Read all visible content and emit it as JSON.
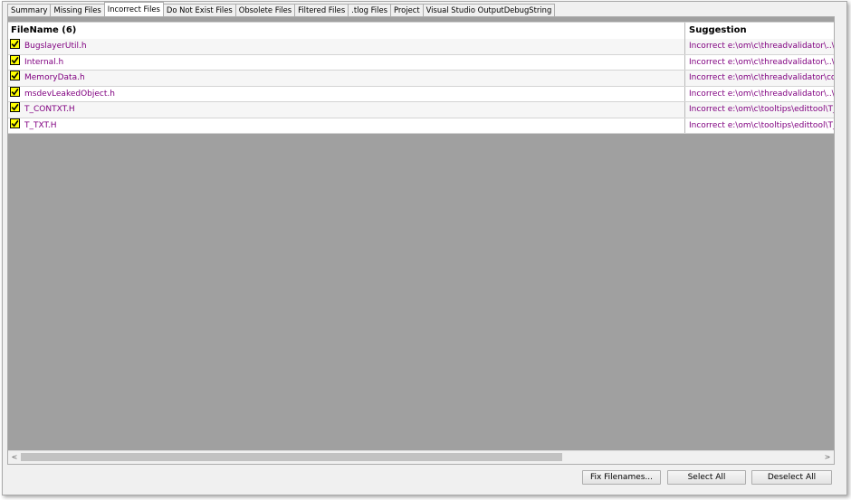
{
  "tabs": [
    {
      "label": "Summary",
      "active": false
    },
    {
      "label": "Missing Files",
      "active": false
    },
    {
      "label": "Incorrect Files",
      "active": true
    },
    {
      "label": "Do Not Exist Files",
      "active": false
    },
    {
      "label": "Obsolete Files",
      "active": false
    },
    {
      "label": "Filtered Files",
      "active": false
    },
    {
      "label": ".tlog Files",
      "active": false
    },
    {
      "label": "Project",
      "active": false
    },
    {
      "label": "Visual Studio OutputDebugString",
      "active": false
    }
  ],
  "table": {
    "columns": [
      "FileName (6)",
      "Suggestion"
    ],
    "rows": [
      {
        "checked": true,
        "filename": "BugslayerUtil.h",
        "suggestion": "Incorrect e:\\om\\c\\threadvalidator\\..\\svlC"
      },
      {
        "checked": true,
        "filename": "Internal.h",
        "suggestion": "Incorrect e:\\om\\c\\threadvalidator\\..\\svlC"
      },
      {
        "checked": true,
        "filename": "MemoryData.h",
        "suggestion": "Incorrect e:\\om\\c\\threadvalidator\\comm"
      },
      {
        "checked": true,
        "filename": "msdevLeakedObject.h",
        "suggestion": "Incorrect e:\\om\\c\\threadvalidator\\..\\svlC"
      },
      {
        "checked": true,
        "filename": "T_CONTXT.H",
        "suggestion": "Incorrect e:\\om\\c\\tooltips\\edittool\\T_CO"
      },
      {
        "checked": true,
        "filename": "T_TXT.H",
        "suggestion": "Incorrect e:\\om\\c\\tooltips\\edittool\\T_TX"
      }
    ]
  },
  "icons": {
    "checkbox": "checkbox-checked-icon",
    "scroll_left": "chevron-left-icon",
    "scroll_right": "chevron-right-icon"
  },
  "scrollbar_arrows": {
    "left": "<",
    "right": ">"
  },
  "buttons": {
    "fix": "Fix Filenames...",
    "select_all": "Select All",
    "deselect_all": "Deselect All"
  },
  "colors": {
    "link_text": "#800080",
    "checkbox_fill": "#ffff00",
    "empty_grid": "#a0a0a0"
  }
}
